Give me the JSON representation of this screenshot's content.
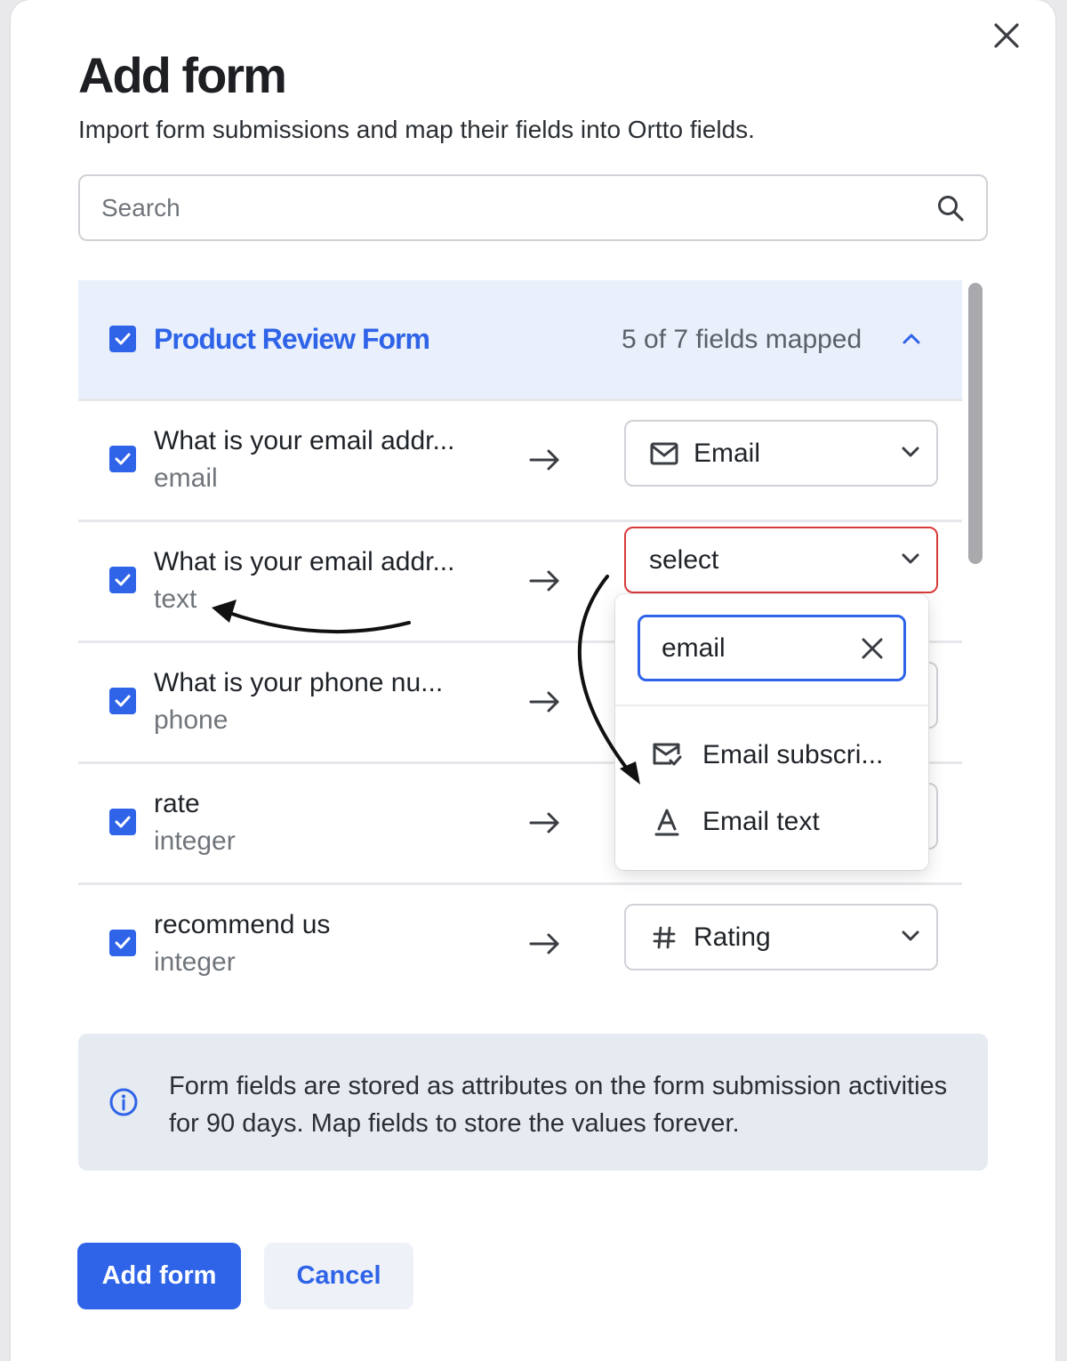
{
  "modal": {
    "title": "Add form",
    "subtitle": "Import form submissions and map their fields into Ortto fields."
  },
  "search": {
    "placeholder": "Search"
  },
  "group": {
    "name": "Product Review Form",
    "mapped_count": "5 of 7 fields mapped",
    "checked": true
  },
  "fields": [
    {
      "question": "What is your email addr...",
      "type": "email",
      "mapped_to": "Email",
      "icon": "envelope-icon"
    },
    {
      "question": "What is your email addr...",
      "type": "text",
      "mapped_to": "select",
      "icon": ""
    },
    {
      "question": "What is your phone nu...",
      "type": "phone",
      "mapped_to": "",
      "icon": ""
    },
    {
      "question": "rate",
      "type": "integer",
      "mapped_to": "",
      "icon": ""
    },
    {
      "question": "recommend us",
      "type": "integer",
      "mapped_to": "Rating",
      "icon": "hash-icon"
    }
  ],
  "dropdown": {
    "search_value": "email",
    "options": [
      {
        "label": "Email subscri...",
        "icon": "email-check-icon"
      },
      {
        "label": "Email text",
        "icon": "text-format-icon"
      }
    ]
  },
  "info": {
    "text": "Form fields are stored as attributes on the form submission activities for 90 days. Map fields to store the values forever."
  },
  "actions": {
    "primary_label": "Add form",
    "secondary_label": "Cancel"
  },
  "colors": {
    "accent": "#2f64e8",
    "error": "#d93a3a",
    "header_bg": "#eaf0fb",
    "info_bg": "#e6ebf2"
  }
}
